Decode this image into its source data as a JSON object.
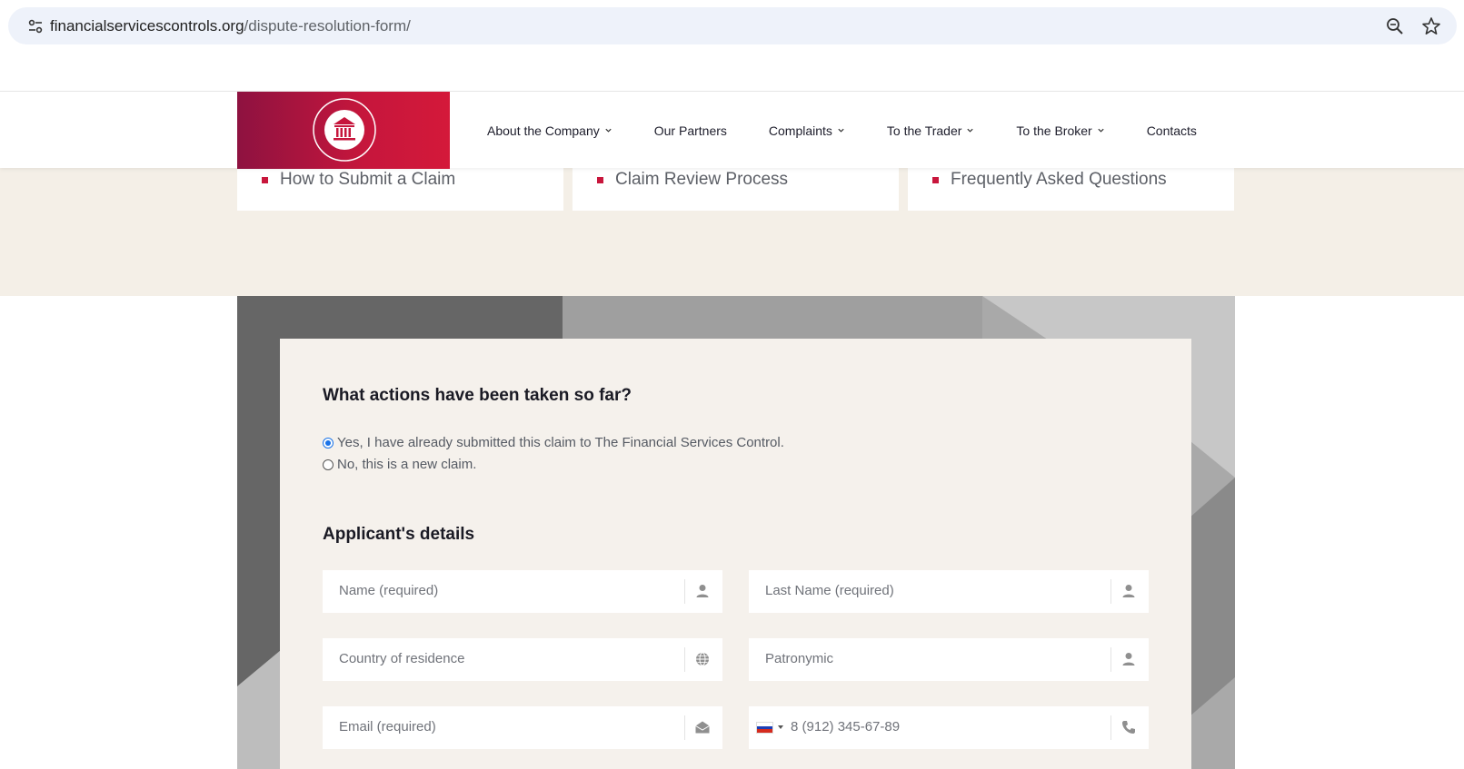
{
  "browser": {
    "url_host": "financialservicescontrols.org",
    "url_path": "/dispute-resolution-form/"
  },
  "header": {
    "nav": [
      {
        "label": "About the Company",
        "has_dropdown": true
      },
      {
        "label": "Our Partners",
        "has_dropdown": false
      },
      {
        "label": "Complaints",
        "has_dropdown": true
      },
      {
        "label": "To the Trader",
        "has_dropdown": true
      },
      {
        "label": "To the Broker",
        "has_dropdown": true
      },
      {
        "label": "Contacts",
        "has_dropdown": false
      }
    ],
    "brand_color": "#c6163c"
  },
  "cards": [
    {
      "label": "How to Submit a Claim"
    },
    {
      "label": "Claim Review Process"
    },
    {
      "label": "Frequently Asked Questions"
    }
  ],
  "form": {
    "actions_title": "What actions have been taken so far?",
    "radio_options": [
      {
        "label": "Yes, I have already submitted this claim to The Financial Services Control.",
        "checked": true
      },
      {
        "label": "No, this is a new claim.",
        "checked": false
      }
    ],
    "applicant_title": "Applicant's details",
    "fields": {
      "name": {
        "placeholder": "Name (required)",
        "icon": "user-icon"
      },
      "last_name": {
        "placeholder": "Last Name (required)",
        "icon": "user-icon"
      },
      "country": {
        "placeholder": "Country of residence",
        "icon": "globe-icon"
      },
      "patronymic": {
        "placeholder": "Patronymic",
        "icon": "user-icon"
      },
      "email": {
        "placeholder": "Email (required)",
        "icon": "envelope-icon"
      },
      "phone": {
        "placeholder": "8 (912) 345-67-89",
        "icon": "phone-icon",
        "flag": "russia-flag"
      }
    }
  }
}
